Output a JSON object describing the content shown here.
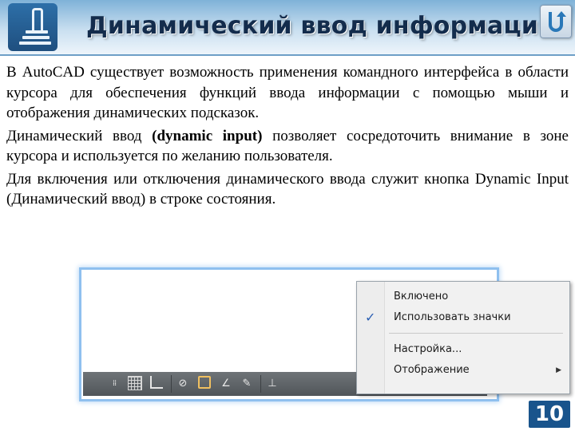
{
  "header": {
    "title": "Динамический ввод информации",
    "back_icon": "u-turn-back-icon",
    "logo_icon": "document-stack-logo"
  },
  "content": {
    "paragraphs": [
      {
        "before": "В AutoCAD существует возможность применения командного интерфейса в области курсора для обеспечения функций ввода информации с помощью мыши и отображения динамических подсказок.",
        "bold": "",
        "after": ""
      },
      {
        "before": "Динамический ввод ",
        "bold": "(dynamic input)",
        "after": " позволяет сосредоточить внимание в зоне курсора и используется по желанию пользователя."
      },
      {
        "before": "Для включения или отключения динамического ввода служит кнопка Dynamic Input (Динамический ввод) в строке состояния.",
        "bold": "",
        "after": ""
      }
    ]
  },
  "screenshot": {
    "context_menu": {
      "items": [
        {
          "label": "Включено",
          "checked": false,
          "submenu": false
        },
        {
          "label": "Использовать значки",
          "checked": true,
          "submenu": false
        },
        {
          "label": "Настройка...",
          "checked": false,
          "submenu": false
        },
        {
          "label": "Отображение",
          "checked": false,
          "submenu": true
        }
      ]
    },
    "status_icons": [
      "snap-dots-icon",
      "grid-icon",
      "ortho-icon",
      "polar-icon",
      "osnap-box-icon",
      "angle-icon",
      "otrack-icon",
      "ucs-icon",
      "dynamic-input-icon",
      "lineweight-icon",
      "model-icon"
    ]
  },
  "colors": {
    "title": "#132c4c",
    "accent": "#19548c",
    "check": "#2b5fb3"
  },
  "page_number": "10"
}
